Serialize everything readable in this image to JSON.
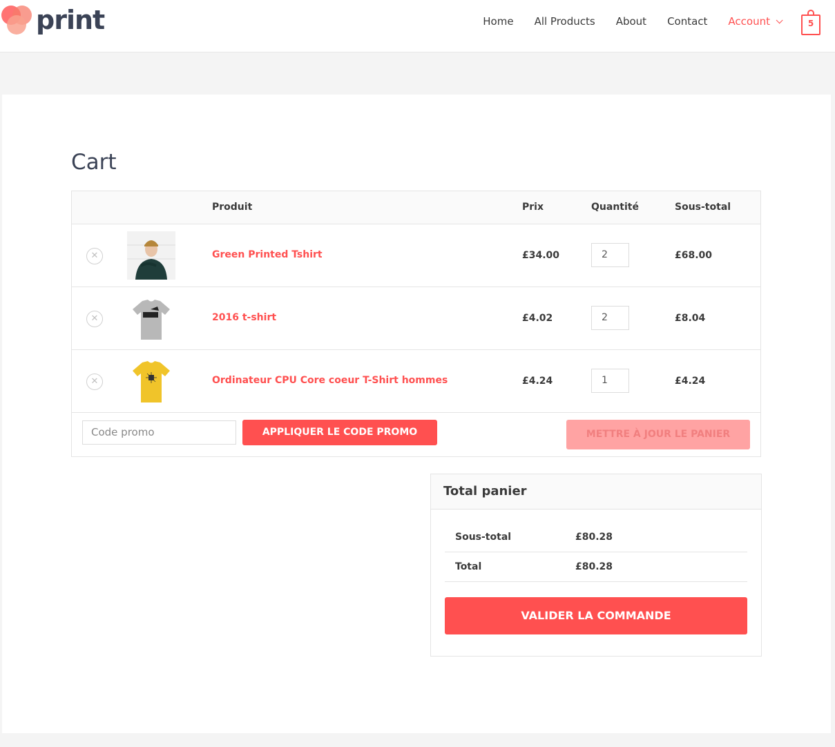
{
  "brand": {
    "name": "print",
    "accent": "#ff5050",
    "logo_circle_colors": [
      "#ff5050",
      "#f77b6a",
      "#f9a18e"
    ]
  },
  "nav": {
    "items": [
      "Home",
      "All Products",
      "About",
      "Contact"
    ],
    "account_label": "Account",
    "cart_count": "5"
  },
  "page": {
    "title": "Cart"
  },
  "cart": {
    "headers": {
      "product": "Produit",
      "price": "Prix",
      "quantity": "Quantité",
      "subtotal": "Sous-total"
    },
    "rows": [
      {
        "name": "Green Printed Tshirt",
        "price": "£34.00",
        "qty": "2",
        "subtotal": "£68.00",
        "thumb": "person-photo"
      },
      {
        "name": "2016 t-shirt",
        "price": "£4.02",
        "qty": "2",
        "subtotal": "£8.04",
        "thumb": "grey-tshirt"
      },
      {
        "name": "Ordinateur CPU Core coeur T-Shirt hommes",
        "price": "£4.24",
        "qty": "1",
        "subtotal": "£4.24",
        "thumb": "yellow-tshirt"
      }
    ],
    "coupon_placeholder": "Code promo",
    "apply_coupon_label": "APPLIQUER LE CODE PROMO",
    "update_cart_label": "METTRE À JOUR LE PANIER"
  },
  "totals": {
    "title": "Total panier",
    "subtotal_label": "Sous-total",
    "subtotal_value": "£80.28",
    "total_label": "Total",
    "total_value": "£80.28",
    "checkout_label": "VALIDER LA COMMANDE"
  }
}
